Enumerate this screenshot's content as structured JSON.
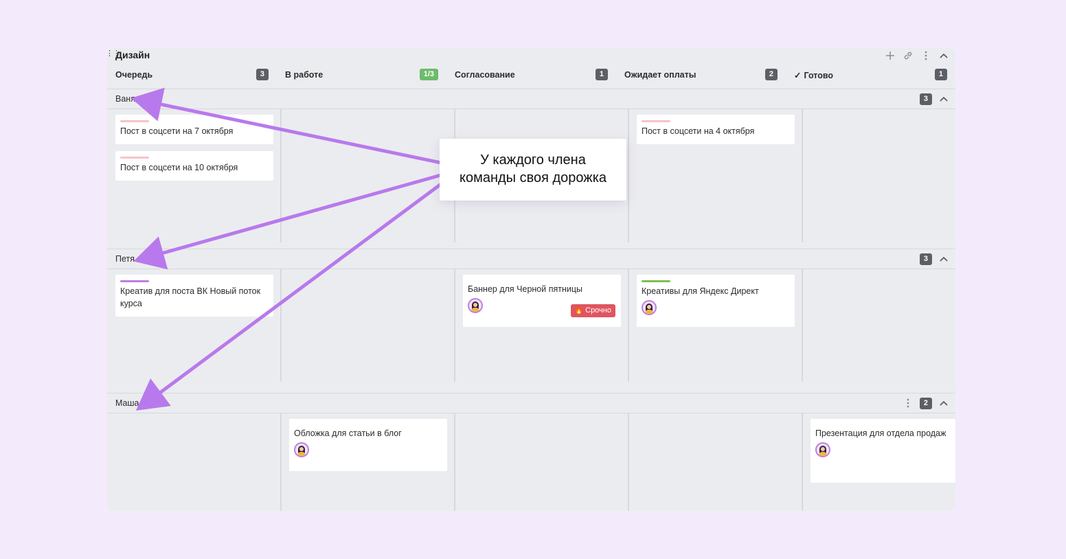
{
  "board": {
    "title": "Дизайн",
    "actions": [
      {
        "name": "add-icon",
        "glyph": "+"
      },
      {
        "name": "link-icon",
        "glyph": "🔗"
      },
      {
        "name": "more-icon",
        "glyph": "⋮"
      },
      {
        "name": "collapse-icon",
        "glyph": "⌃"
      }
    ]
  },
  "columns": [
    {
      "label": "Очередь",
      "count": "3",
      "count_color": "#5c5f66"
    },
    {
      "label": "В работе",
      "count": "1/3",
      "count_color": "#6dbb6b"
    },
    {
      "label": "Согласование",
      "count": "1",
      "count_color": "#5c5f66"
    },
    {
      "label": "Ожидает оплаты",
      "count": "2",
      "count_color": "#5c5f66"
    },
    {
      "label": "Готово",
      "count": "1",
      "count_color": "#5c5f66",
      "check_icon": "✓"
    }
  ],
  "lanes": {
    "vanya": {
      "name": "Ваня",
      "count": "3",
      "cards": {
        "c1": {
          "title": "Пост в соцсети на 7 октября",
          "stripe": "#f7c3c7"
        },
        "c2": {
          "title": "Пост в соцсети на 10 октября",
          "stripe": "#f7c3c7"
        },
        "c3": {
          "title": "Пост в соцсети на 4 октября",
          "stripe": "#f7c3c7"
        }
      }
    },
    "petya": {
      "name": "Петя",
      "count": "3",
      "cards": {
        "c1": {
          "title": "Креатив для поста ВК Новый поток курса",
          "stripe": "#c07de0"
        },
        "c2": {
          "title": "Баннер для Черной пятницы",
          "tag": "Срочно",
          "tag_icon": "🔥"
        },
        "c3": {
          "title": "Креативы для Яндекс Директ",
          "stripe": "#7dc04f"
        }
      }
    },
    "masha": {
      "name": "Маша",
      "count": "2",
      "cards": {
        "c1": {
          "title": "Обложка для статьи в блог"
        },
        "c2": {
          "title": "Презентация для отдела продаж"
        }
      }
    }
  },
  "callout": {
    "line1": "У каждого члена",
    "line2": "команды своя дорожка"
  },
  "colors": {
    "background": "#f3eafc",
    "board": "#ebecef",
    "arrow": "#b879ec",
    "urgent_tag": "#e0555f"
  }
}
